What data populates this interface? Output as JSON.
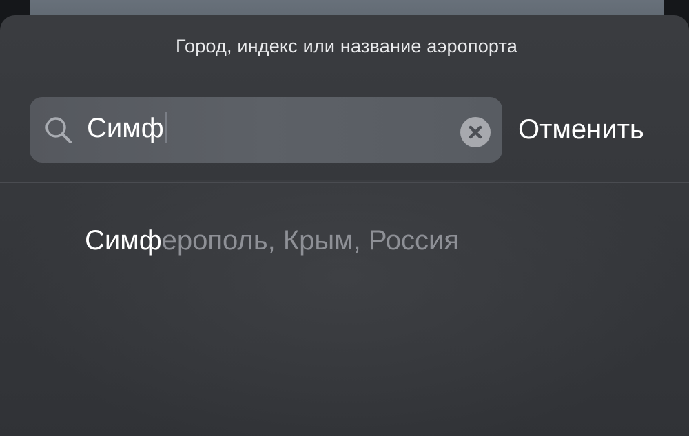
{
  "header": {
    "prompt": "Город, индекс или название аэропорта"
  },
  "search": {
    "value": "Симф",
    "search_icon": "magnifying-glass",
    "clear_icon": "circle-x"
  },
  "cancel_label": "Отменить",
  "results": [
    {
      "match": "Симф",
      "rest": "ерополь, Крым, Россия"
    }
  ],
  "colors": {
    "sheet": "#38393d",
    "field": "#5a5d63",
    "text": "#ffffff",
    "secondary_text": "#8e9096"
  }
}
